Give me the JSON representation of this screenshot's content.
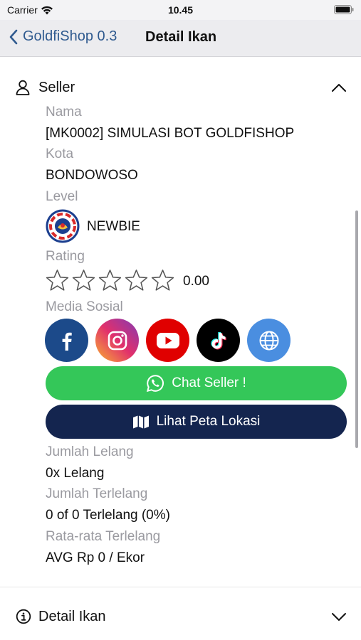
{
  "status_bar": {
    "carrier": "Carrier",
    "time": "10.45"
  },
  "nav": {
    "back_label": "GoldfiShop 0.3",
    "title": "Detail Ikan"
  },
  "seller_section": {
    "header": "Seller",
    "nama_label": "Nama",
    "nama_value": "[MK0002] SIMULASI BOT GOLDFISHOP",
    "kota_label": "Kota",
    "kota_value": "BONDOWOSO",
    "level_label": "Level",
    "level_value": "NEWBIE",
    "rating_label": "Rating",
    "rating_value": "0.00",
    "rating_stars": 0,
    "rating_max": 5,
    "media_label": "Media Sosial",
    "social_links": [
      {
        "name": "facebook",
        "icon": "facebook-icon",
        "color": "#1c4a8a"
      },
      {
        "name": "instagram",
        "icon": "instagram-icon",
        "color": "#c13584"
      },
      {
        "name": "youtube",
        "icon": "youtube-icon",
        "color": "#e00000"
      },
      {
        "name": "tiktok",
        "icon": "tiktok-icon",
        "color": "#000000"
      },
      {
        "name": "website",
        "icon": "globe-icon",
        "color": "#4a8ee0"
      }
    ],
    "chat_button": "Chat Seller !",
    "map_button": "Lihat Peta Lokasi",
    "jumlah_lelang_label": "Jumlah Lelang",
    "jumlah_lelang_value": "0x Lelang",
    "jumlah_terlelang_label": "Jumlah Terlelang",
    "jumlah_terlelang_value": "0 of 0 Terlelang (0%)",
    "rata_label": "Rata-rata Terlelang",
    "rata_value": "AVG Rp 0 / Ekor"
  },
  "detail_section": {
    "header": "Detail Ikan"
  },
  "colors": {
    "accent": "#2f5a8f",
    "chat_green": "#34c759",
    "map_navy": "#14254f"
  }
}
